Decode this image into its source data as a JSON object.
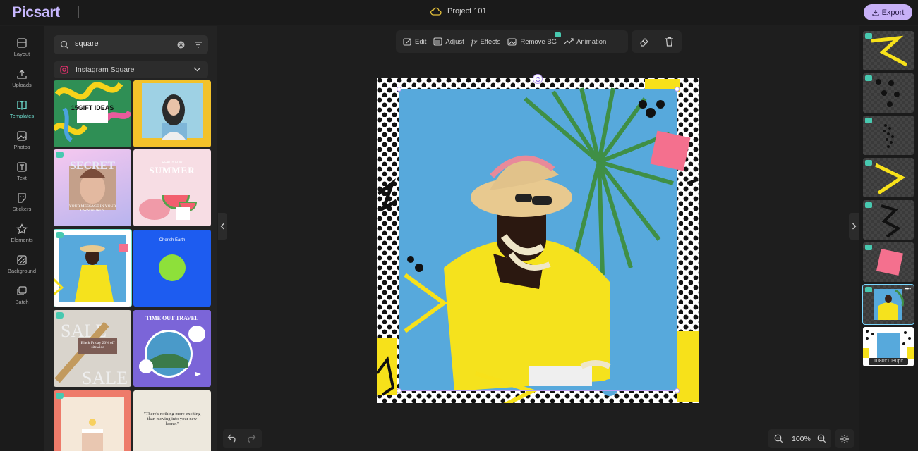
{
  "app": {
    "logo": "Picsart",
    "project_name": "Project 101",
    "export_label": "Export"
  },
  "rail": [
    {
      "label": "Layout",
      "icon": "layout-icon"
    },
    {
      "label": "Uploads",
      "icon": "upload-icon"
    },
    {
      "label": "Templates",
      "icon": "templates-icon",
      "active": true
    },
    {
      "label": "Photos",
      "icon": "photos-icon"
    },
    {
      "label": "Text",
      "icon": "text-icon"
    },
    {
      "label": "Stickers",
      "icon": "stickers-icon"
    },
    {
      "label": "Elements",
      "icon": "star-icon"
    },
    {
      "label": "Background",
      "icon": "background-icon"
    },
    {
      "label": "Batch",
      "icon": "batch-icon"
    }
  ],
  "panel": {
    "search_value": "square",
    "category": "Instagram Square",
    "templates": [
      {
        "text": "15GIFT IDEAS"
      },
      {
        "text": ""
      },
      {
        "text": "YOUR MESSAGE IN YOUR OWN WORDS"
      },
      {
        "text": "READY FOR SUMMER"
      },
      {
        "text": ""
      },
      {
        "text": "Cherish Earth"
      },
      {
        "text": "Black Friday 20% off sitewide"
      },
      {
        "text": "TIME OUT TRAVEL"
      },
      {
        "text": ""
      },
      {
        "text": "\"There's nothing more exciting than moving into your new home.\""
      }
    ]
  },
  "toolbar": {
    "tools": [
      "Edit",
      "Adjust",
      "Effects",
      "Remove BG",
      "Animation"
    ]
  },
  "zoom": {
    "level": "100%"
  },
  "layers": {
    "size_label": "1080x1080px"
  },
  "colors": {
    "accent": "#c7b0f7",
    "teal": "#48c9b0",
    "yellow": "#f7e11a",
    "pink": "#f4708e",
    "sky": "#57a9dc"
  }
}
